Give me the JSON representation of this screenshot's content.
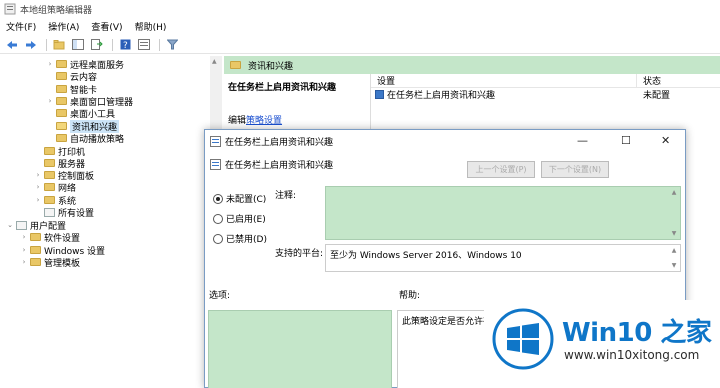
{
  "window": {
    "title": "本地组策略编辑器"
  },
  "menu": [
    "文件(F)",
    "操作(A)",
    "查看(V)",
    "帮助(H)"
  ],
  "toolbar": {
    "icons": [
      "back-arrow",
      "forward-arrow",
      "up-folder",
      "show-hide-tree",
      "export-list",
      "help",
      "properties",
      "filter"
    ]
  },
  "tree": {
    "items": [
      {
        "label": "远程桌面服务",
        "arrow": "›"
      },
      {
        "label": "云内容",
        "arrow": ""
      },
      {
        "label": "智能卡",
        "arrow": ""
      },
      {
        "label": "桌面窗口管理器",
        "arrow": "›"
      },
      {
        "label": "桌面小工具",
        "arrow": ""
      },
      {
        "label": "资讯和兴趣",
        "arrow": ""
      },
      {
        "label": "自动播放策略",
        "arrow": ""
      },
      {
        "label": "打印机",
        "arrow": ""
      },
      {
        "label": "服务器",
        "arrow": ""
      },
      {
        "label": "控制面板",
        "arrow": "›"
      },
      {
        "label": "网络",
        "arrow": "›"
      },
      {
        "label": "系统",
        "arrow": "›"
      },
      {
        "label": "所有设置",
        "arrow": ""
      },
      {
        "label": "用户配置",
        "arrow": "⌄"
      },
      {
        "label": "软件设置",
        "arrow": "›"
      },
      {
        "label": "Windows 设置",
        "arrow": "›"
      },
      {
        "label": "管理模板",
        "arrow": "›"
      }
    ]
  },
  "right_pane": {
    "header": "资讯和兴趣",
    "policy_title": "在任务栏上启用资讯和兴趣",
    "edit_prefix": "编辑",
    "edit_link": "策略设置",
    "columns": [
      "设置",
      "状态"
    ],
    "rows": [
      {
        "setting": "在任务栏上启用资讯和兴趣",
        "status": "未配置"
      }
    ]
  },
  "dialog": {
    "title": "在任务栏上启用资讯和兴趣",
    "subtitle": "在任务栏上启用资讯和兴趣",
    "prev_button": "上一个设置(P)",
    "next_button": "下一个设置(N)",
    "radio_options": [
      "未配置(C)",
      "已启用(E)",
      "已禁用(D)"
    ],
    "selected_option": 0,
    "comment_label": "注释:",
    "platform_label": "支持的平台:",
    "platform_value": "至少为 Windows Server 2016、Windows 10",
    "options_label": "选项:",
    "help_label": "帮助:",
    "help_text": "此策略设定是否允许在"
  },
  "watermark": {
    "title": "Win10 之家",
    "url": "www.win10xitong.com"
  },
  "colors": {
    "green": "#c4e6c9",
    "link": "#1a4fd0",
    "watermark_blue": "#0f76c8"
  }
}
